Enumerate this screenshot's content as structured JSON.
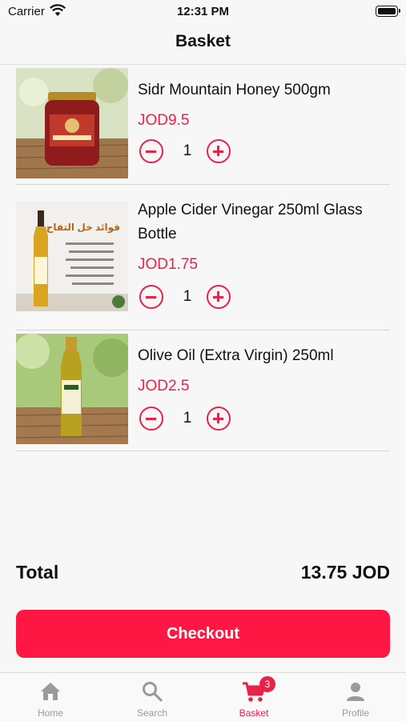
{
  "status_bar": {
    "carrier": "Carrier",
    "time": "12:31 PM"
  },
  "header": {
    "title": "Basket"
  },
  "items": [
    {
      "name": "Sidr Mountain Honey 500gm",
      "price": "JOD9.5",
      "qty": "1"
    },
    {
      "name": "Apple Cider Vinegar 250ml Glass Bottle",
      "price": "JOD1.75",
      "qty": "1",
      "image_text": "فوائد خل التفاح"
    },
    {
      "name": "Olive Oil (Extra Virgin) 250ml",
      "price": "JOD2.5",
      "qty": "1"
    }
  ],
  "total": {
    "label": "Total",
    "value": "13.75 JOD"
  },
  "checkout_label": "Checkout",
  "tabs": [
    {
      "label": "Home",
      "icon": "home-icon"
    },
    {
      "label": "Search",
      "icon": "search-icon"
    },
    {
      "label": "Basket",
      "icon": "cart-icon",
      "badge": "3"
    },
    {
      "label": "Profile",
      "icon": "person-icon"
    }
  ],
  "colors": {
    "accent": "#e8234a",
    "checkout": "#ff1744"
  }
}
